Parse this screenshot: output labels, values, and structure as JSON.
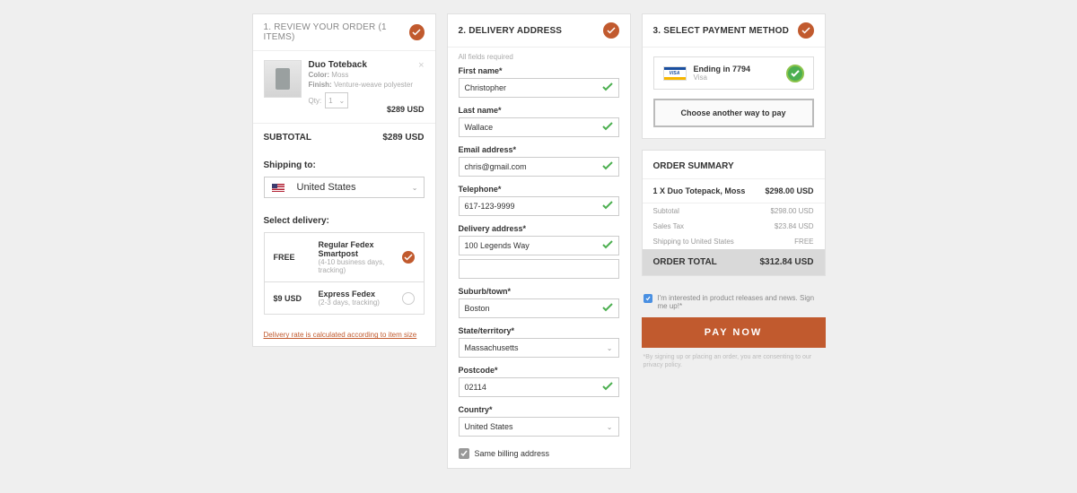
{
  "review": {
    "title": "1. REVIEW YOUR ORDER",
    "count": "(1 ITEMS)",
    "item": {
      "name": "Duo Toteback",
      "color_label": "Color:",
      "color": "Moss",
      "finish_label": "Finish:",
      "finish": "Venture-weave polyester",
      "qty_label": "Qty:",
      "qty": "1",
      "price": "$289 USD"
    },
    "subtotal_label": "SUBTOTAL",
    "subtotal": "$289 USD",
    "shipto_label": "Shipping to:",
    "country": "United States",
    "delivery_label": "Select delivery:",
    "options": [
      {
        "price": "FREE",
        "title": "Regular Fedex Smartpost",
        "sub": "(4-10 business days, tracking)",
        "selected": true
      },
      {
        "price": "$9 USD",
        "title": "Express Fedex",
        "sub": "(2-3 days, tracking)",
        "selected": false
      }
    ],
    "note": "Delivery rate is calculated according to item size"
  },
  "delivery": {
    "title": "2. DELIVERY ADDRESS",
    "hint": "All fields required",
    "fields": {
      "firstname": {
        "label": "First name*",
        "value": "Christopher"
      },
      "lastname": {
        "label": "Last name*",
        "value": "Wallace"
      },
      "email": {
        "label": "Email address*",
        "value": "chris@gmail.com"
      },
      "phone": {
        "label": "Telephone*",
        "value": "617-123-9999"
      },
      "address": {
        "label": "Delivery address*",
        "value": "100 Legends Way"
      },
      "address2": {
        "value": ""
      },
      "suburb": {
        "label": "Suburb/town*",
        "value": "Boston"
      },
      "state": {
        "label": "State/territory*",
        "value": "Massachusetts"
      },
      "postcode": {
        "label": "Postcode*",
        "value": "02114"
      },
      "country": {
        "label": "Country*",
        "value": "United States"
      }
    },
    "samebilling": "Same billing address"
  },
  "payment": {
    "title": "3. SELECT PAYMENT METHOD",
    "card": {
      "ending": "Ending in 7794",
      "type": "Visa"
    },
    "alt": "Choose another way to pay"
  },
  "summary": {
    "title": "ORDER SUMMARY",
    "lineitem": {
      "desc": "1 X Duo Totepack, Moss",
      "amt": "$298.00 USD"
    },
    "rows": [
      {
        "label": "Subtotal",
        "amt": "$298.00 USD"
      },
      {
        "label": "Sales Tax",
        "amt": "$23.84 USD"
      },
      {
        "label": "Shipping to United States",
        "amt": "FREE"
      }
    ],
    "total_label": "ORDER TOTAL",
    "total": "$312.84 USD",
    "optin": "I'm interested in product releases and news. Sign me up!*",
    "pay": "PAY NOW",
    "legal": "*By signing up or placing an order, you are consenting to our privacy policy."
  }
}
